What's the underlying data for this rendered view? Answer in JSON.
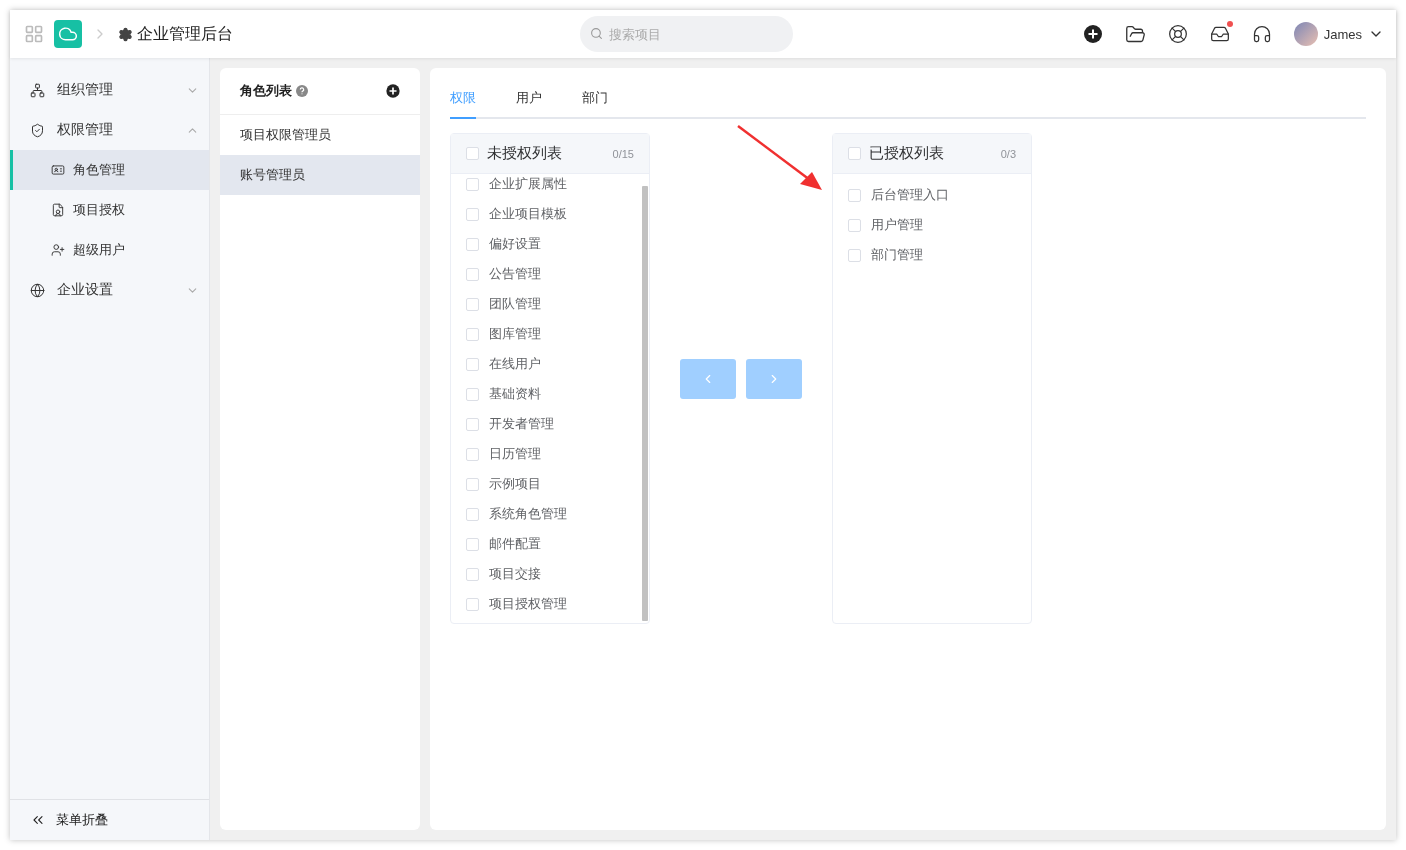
{
  "header": {
    "title": "企业管理后台",
    "search": {
      "placeholder": "搜索项目"
    },
    "notification_dot": true,
    "user": "James"
  },
  "sidebar": {
    "groups": [
      {
        "label": "组织管理",
        "expanded": false
      },
      {
        "label": "权限管理",
        "expanded": true,
        "children": [
          {
            "label": "角色管理",
            "selected": true
          },
          {
            "label": "项目授权",
            "selected": false
          },
          {
            "label": "超级用户",
            "selected": false
          }
        ]
      },
      {
        "label": "企业设置",
        "expanded": false
      }
    ],
    "collapse": "菜单折叠"
  },
  "roles": {
    "title": "角色列表",
    "items": [
      {
        "label": "项目权限管理员",
        "selected": false
      },
      {
        "label": "账号管理员",
        "selected": true
      }
    ]
  },
  "tabs": [
    {
      "label": "权限",
      "selected": true
    },
    {
      "label": "用户",
      "selected": false
    },
    {
      "label": "部门",
      "selected": false
    }
  ],
  "transfer": {
    "left": {
      "title": "未授权列表",
      "count": "0/15",
      "checked": false,
      "items": [
        {
          "label": "企业扩展属性",
          "checked": false
        },
        {
          "label": "企业项目模板",
          "checked": false
        },
        {
          "label": "偏好设置",
          "checked": false
        },
        {
          "label": "公告管理",
          "checked": false
        },
        {
          "label": "团队管理",
          "checked": false
        },
        {
          "label": "图库管理",
          "checked": false
        },
        {
          "label": "在线用户",
          "checked": false
        },
        {
          "label": "基础资料",
          "checked": false
        },
        {
          "label": "开发者管理",
          "checked": false
        },
        {
          "label": "日历管理",
          "checked": false
        },
        {
          "label": "示例项目",
          "checked": false
        },
        {
          "label": "系统角色管理",
          "checked": false
        },
        {
          "label": "邮件配置",
          "checked": false
        },
        {
          "label": "项目交接",
          "checked": false
        },
        {
          "label": "项目授权管理",
          "checked": false
        }
      ]
    },
    "buttons": [
      {
        "kind": "left",
        "disabled": true
      },
      {
        "kind": "right",
        "disabled": true
      }
    ],
    "right": {
      "title": "已授权列表",
      "count": "0/3",
      "checked": false,
      "items": [
        {
          "label": "后台管理入口",
          "checked": false
        },
        {
          "label": "用户管理",
          "checked": false
        },
        {
          "label": "部门管理",
          "checked": false
        }
      ]
    }
  }
}
